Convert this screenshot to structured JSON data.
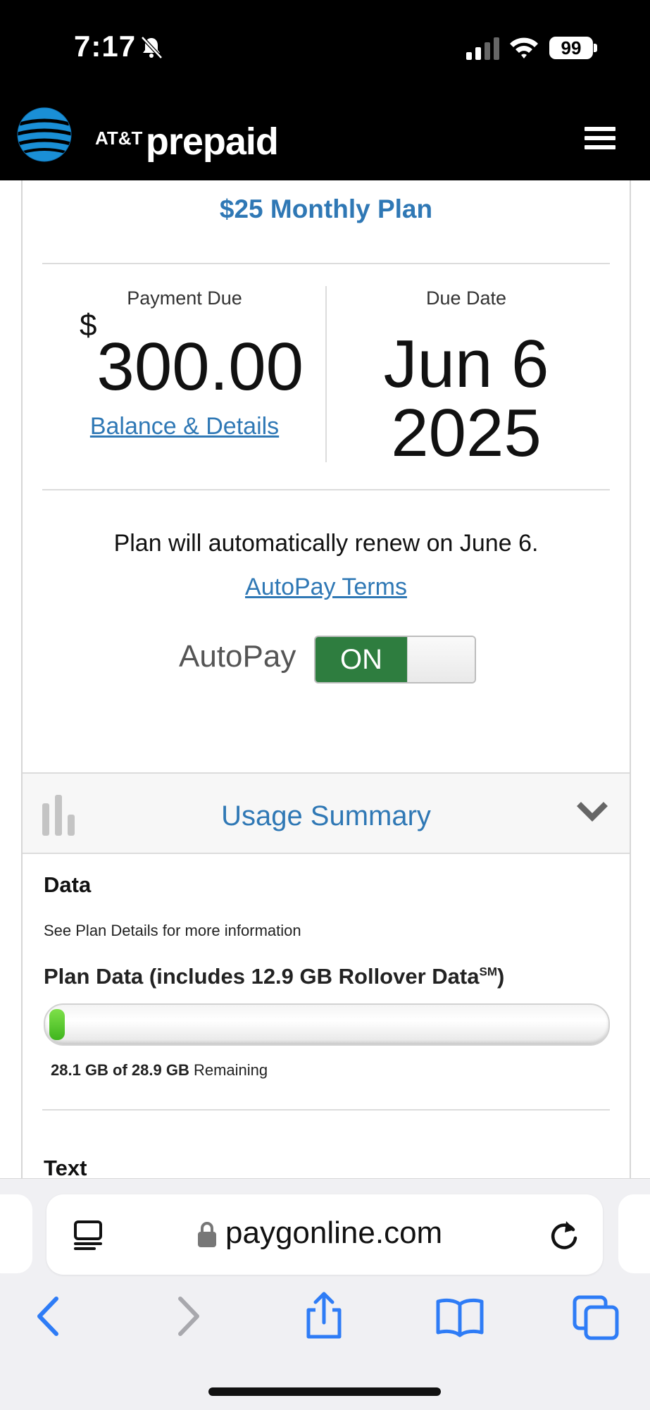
{
  "status_bar": {
    "time": "7:17",
    "battery": "99"
  },
  "header": {
    "brand_att": "AT&T",
    "brand_prepaid": "prepaid"
  },
  "plan": {
    "title": "$25 Monthly Plan",
    "payment_due_label": "Payment Due",
    "currency_symbol": "$",
    "amount": "300.00",
    "balance_link": "Balance & Details",
    "due_date_label": "Due Date",
    "due_date_line1": "Jun 6",
    "due_date_line2": "2025",
    "renew_text": "Plan will automatically renew on June 6.",
    "autopay_terms_link": "AutoPay Terms",
    "autopay_label": "AutoPay",
    "autopay_state": "ON"
  },
  "usage": {
    "title": "Usage Summary",
    "data_title": "Data",
    "data_note": "See Plan Details for more information",
    "plan_data_label": "Plan Data (includes 12.9 GB Rollover Data",
    "plan_data_sup": "SM",
    "plan_data_close": ")",
    "used_fraction": 0.028,
    "remaining_amount": "28.1 GB of 28.9 GB",
    "remaining_word": " Remaining",
    "text_title": "Text"
  },
  "browser": {
    "url": "paygonline.com"
  },
  "colors": {
    "link_blue": "#2f78b5",
    "toggle_green": "#2e7d3f",
    "progress_green": "#4cc52a"
  }
}
